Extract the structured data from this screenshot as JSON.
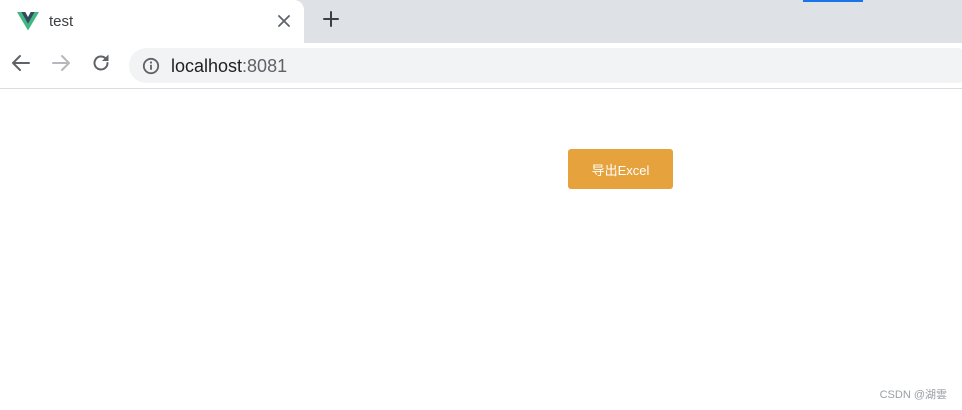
{
  "browser": {
    "tab": {
      "title": "test",
      "favicon_icon": "vue-logo-icon",
      "close_icon": "close-icon"
    },
    "new_tab_icon": "plus-icon",
    "toolbar": {
      "back_icon": "arrow-left-icon",
      "forward_icon": "arrow-right-icon",
      "reload_icon": "reload-icon",
      "site_info_icon": "info-icon",
      "url_host": "localhost",
      "url_port": ":8081"
    },
    "colors": {
      "tabstrip": "#dee1e6",
      "accent": "#1a73e8"
    }
  },
  "page": {
    "export_button": {
      "label": "导出Excel",
      "color": "#e6a23c"
    },
    "watermark": "CSDN @湖雲"
  }
}
